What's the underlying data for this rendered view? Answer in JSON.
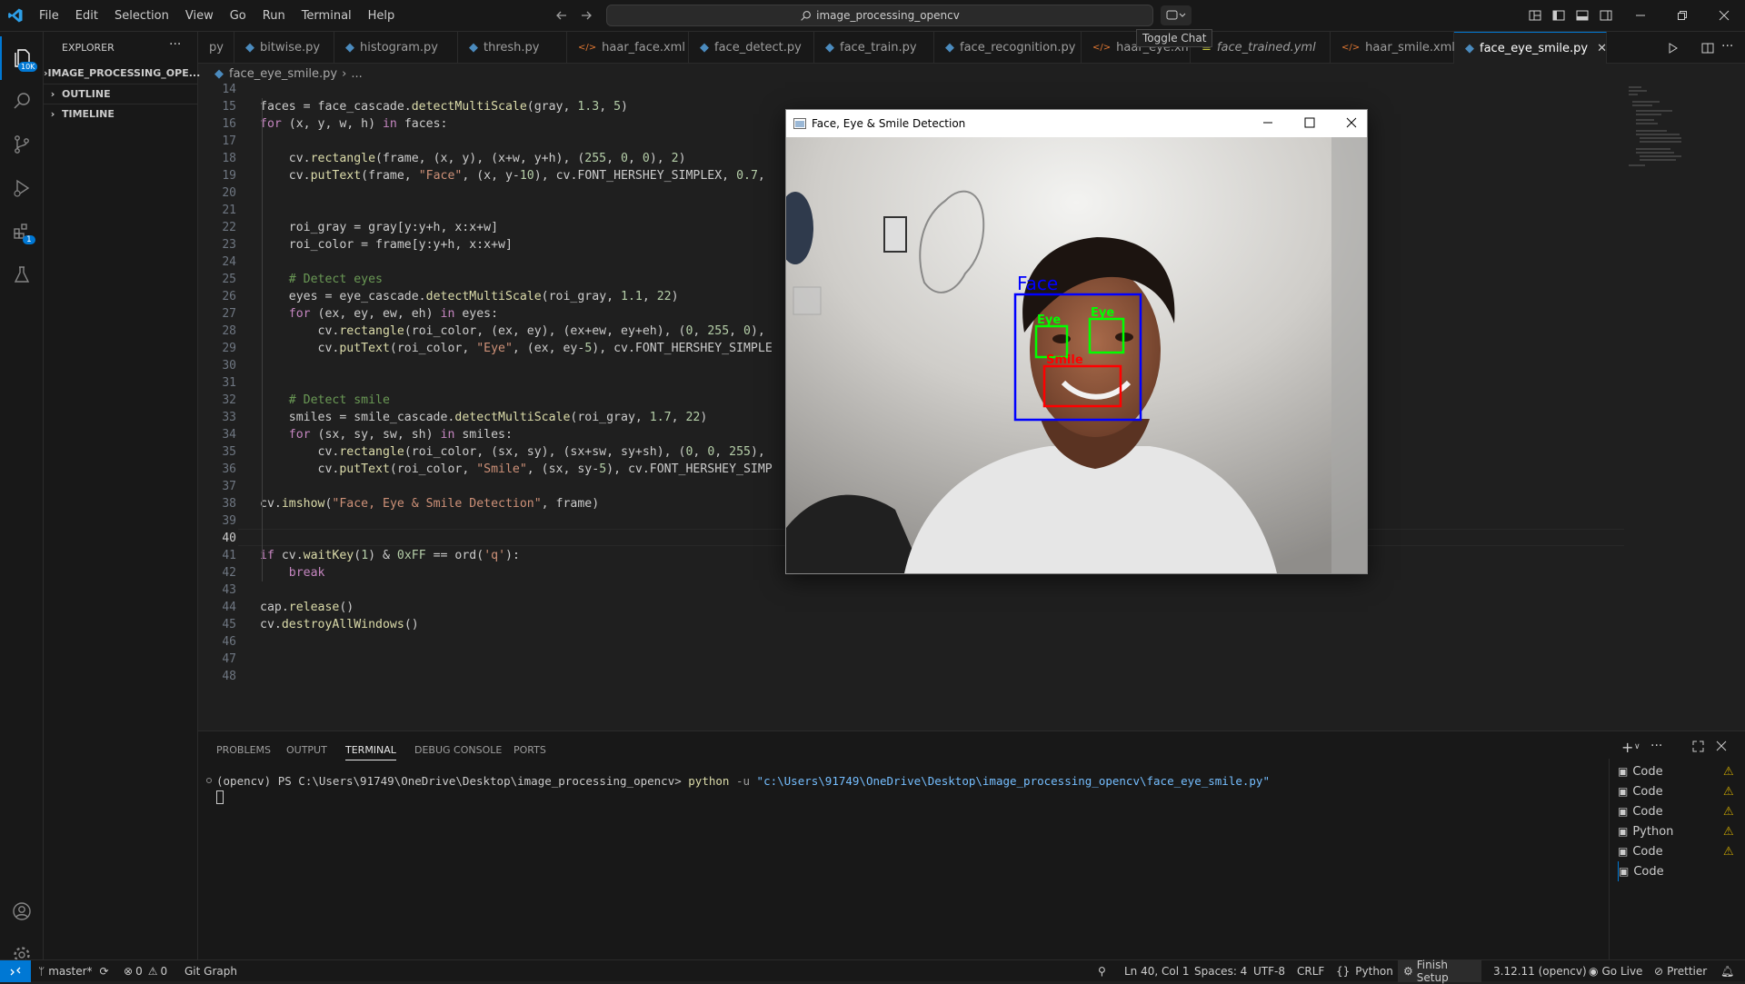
{
  "titlebar": {
    "menu": [
      "File",
      "Edit",
      "Selection",
      "View",
      "Go",
      "Run",
      "Terminal",
      "Help"
    ],
    "search_text": "image_processing_opencv",
    "tooltip": "Toggle Chat"
  },
  "activity": {
    "explorer_badge": "10K",
    "extensions_badge": "1"
  },
  "sidebar": {
    "title": "EXPLORER",
    "sections": [
      "IMAGE_PROCESSING_OPE...",
      "OUTLINE",
      "TIMELINE"
    ]
  },
  "tabs": [
    {
      "label": "py",
      "icon": "python"
    },
    {
      "label": "bitwise.py",
      "icon": "python"
    },
    {
      "label": "histogram.py",
      "icon": "python"
    },
    {
      "label": "thresh.py",
      "icon": "python"
    },
    {
      "label": "haar_face.xml",
      "icon": "xml"
    },
    {
      "label": "face_detect.py",
      "icon": "python"
    },
    {
      "label": "face_train.py",
      "icon": "python"
    },
    {
      "label": "face_recognition.py",
      "icon": "python"
    },
    {
      "label": "haar_eye.xml",
      "icon": "xml"
    },
    {
      "label": "face_trained.yml",
      "icon": "yaml"
    },
    {
      "label": "haar_smile.xml",
      "icon": "xml"
    },
    {
      "label": "face_eye_smile.py",
      "icon": "python"
    }
  ],
  "breadcrumb": {
    "file": "face_eye_smile.py",
    "rest": "..."
  },
  "editor": {
    "lines": [
      "14",
      "15",
      "16",
      "17",
      "18",
      "19",
      "20",
      "21",
      "22",
      "23",
      "24",
      "25",
      "26",
      "27",
      "28",
      "29",
      "30",
      "31",
      "32",
      "33",
      "34",
      "35",
      "36",
      "37",
      "38",
      "39",
      "40",
      "41",
      "42",
      "43",
      "44",
      "45",
      "46",
      "47",
      "48"
    ],
    "code": [
      "",
      "faces = face_cascade.detectMultiScale(gray, 1.3, 5)",
      "for (x, y, w, h) in faces:",
      "",
      "    cv.rectangle(frame, (x, y), (x+w, y+h), (255, 0, 0), 2)",
      "    cv.putText(frame, \"Face\", (x, y-10), cv.FONT_HERSHEY_SIMPLEX, 0.7,",
      "",
      "",
      "    roi_gray = gray[y:y+h, x:x+w]",
      "    roi_color = frame[y:y+h, x:x+w]",
      "",
      "    # Detect eyes",
      "    eyes = eye_cascade.detectMultiScale(roi_gray, 1.1, 22)",
      "    for (ex, ey, ew, eh) in eyes:",
      "        cv.rectangle(roi_color, (ex, ey), (ex+ew, ey+eh), (0, 255, 0),",
      "        cv.putText(roi_color, \"Eye\", (ex, ey-5), cv.FONT_HERSHEY_SIMPLE",
      "",
      "",
      "    # Detect smile",
      "    smiles = smile_cascade.detectMultiScale(roi_gray, 1.7, 22)",
      "    for (sx, sy, sw, sh) in smiles:",
      "        cv.rectangle(roi_color, (sx, sy), (sx+sw, sy+sh), (0, 0, 255),",
      "        cv.putText(roi_color, \"Smile\", (sx, sy-5), cv.FONT_HERSHEY_SIMP",
      "",
      "cv.imshow(\"Face, Eye & Smile Detection\", frame)",
      "",
      "",
      "if cv.waitKey(1) & 0xFF == ord('q'):",
      "    break",
      "",
      "cap.release()",
      "cv.destroyAllWindows()",
      "",
      "",
      ""
    ],
    "current_line": "40"
  },
  "cv_window": {
    "title": "Face, Eye & Smile Detection",
    "labels": {
      "face": "Face",
      "eye1": "Eye",
      "eye2": "Eye",
      "smile": "Smile"
    }
  },
  "panel": {
    "tabs": [
      "PROBLEMS",
      "OUTPUT",
      "TERMINAL",
      "DEBUG CONSOLE",
      "PORTS"
    ],
    "active_tab": "TERMINAL",
    "prompt": "(opencv) PS C:\\Users\\91749\\OneDrive\\Desktop\\image_processing_opencv> ",
    "command": "python",
    "flag": " -u ",
    "path": "\"c:\\Users\\91749\\OneDrive\\Desktop\\image_processing_opencv\\face_eye_smile.py\"",
    "terminals": [
      "Code",
      "Code",
      "Code",
      "Python",
      "Code",
      "Code"
    ]
  },
  "status": {
    "branch": "master*",
    "errors": "0",
    "warnings": "0",
    "git_graph": "Git Graph",
    "position": "Ln 40, Col 1",
    "spaces": "Spaces: 4",
    "encoding": "UTF-8",
    "eol": "CRLF",
    "language": "Python",
    "setup": "Finish Setup",
    "interpreter": "3.12.11 (opencv)",
    "golive": "Go Live",
    "prettier": "Prettier"
  },
  "colors": {
    "accent": "#0078d4",
    "remote": "#0078d4",
    "face_box": "#0000ff",
    "eye_box": "#00ff00",
    "smile_box": "#ff0000"
  }
}
